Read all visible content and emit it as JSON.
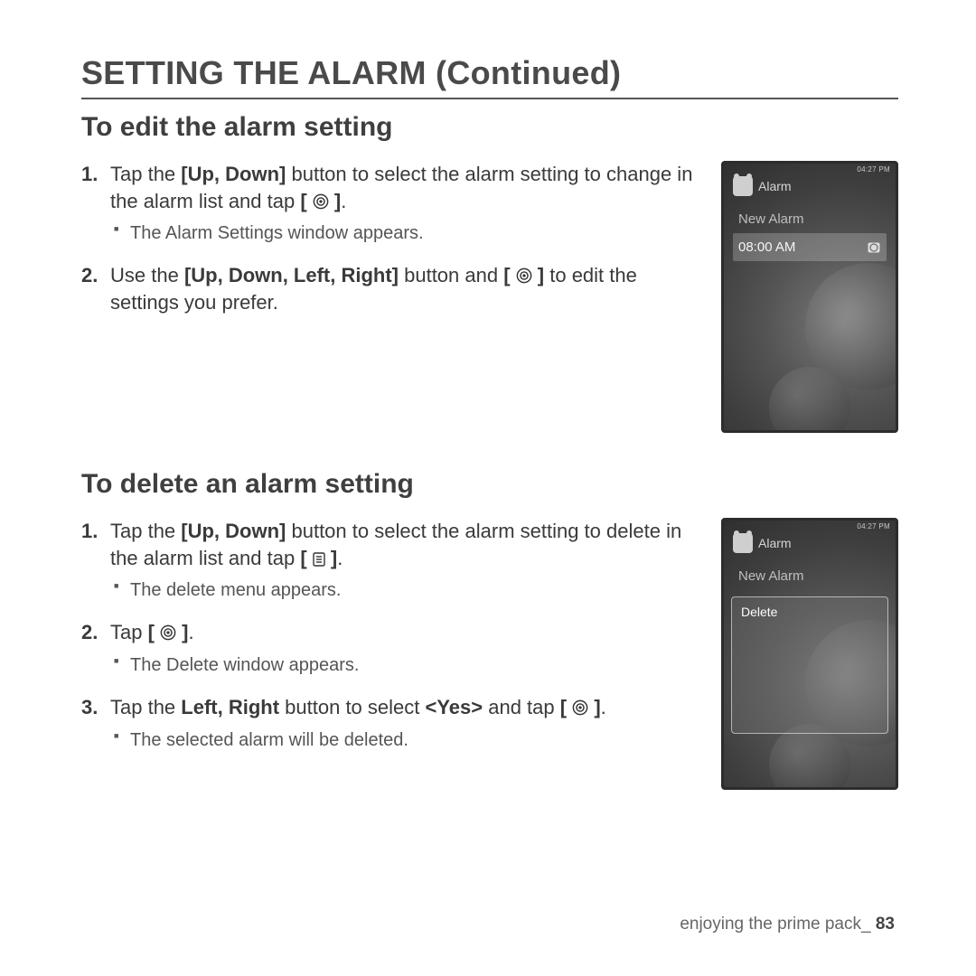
{
  "page": {
    "title": "SETTING THE ALARM (Continued)",
    "footer_text": "enjoying the prime pack_",
    "footer_page": "83"
  },
  "edit": {
    "heading": "To edit the alarm setting",
    "step1_a": "Tap the ",
    "step1_b_bold": "[Up, Down]",
    "step1_c": " button to select the alarm setting to change in the alarm list and tap ",
    "step1_d": ".",
    "step1_sub": "The Alarm Settings window appears.",
    "step2_a": "Use the ",
    "step2_b_bold": "[Up, Down, Left, Right]",
    "step2_c": " button and ",
    "step2_d": " to edit the settings you prefer."
  },
  "delete": {
    "heading": "To delete an alarm setting",
    "step1_a": "Tap the ",
    "step1_b_bold": "[Up, Down]",
    "step1_c": " button to select the alarm setting to delete in the alarm list and tap ",
    "step1_d": ".",
    "step1_sub": "The delete menu appears.",
    "step2_a": "Tap ",
    "step2_b": ".",
    "step2_sub": "The Delete window appears.",
    "step3_a": "Tap the ",
    "step3_b_bold": "Left, Right",
    "step3_c": " button to select ",
    "step3_d_bold": "<Yes>",
    "step3_e": " and tap ",
    "step3_f": ".",
    "step3_sub": "The selected alarm will be deleted."
  },
  "device": {
    "status": "04:27 PM",
    "header": "Alarm",
    "new_alarm": "New Alarm",
    "time_row": "08:00 AM",
    "delete_label": "Delete"
  }
}
